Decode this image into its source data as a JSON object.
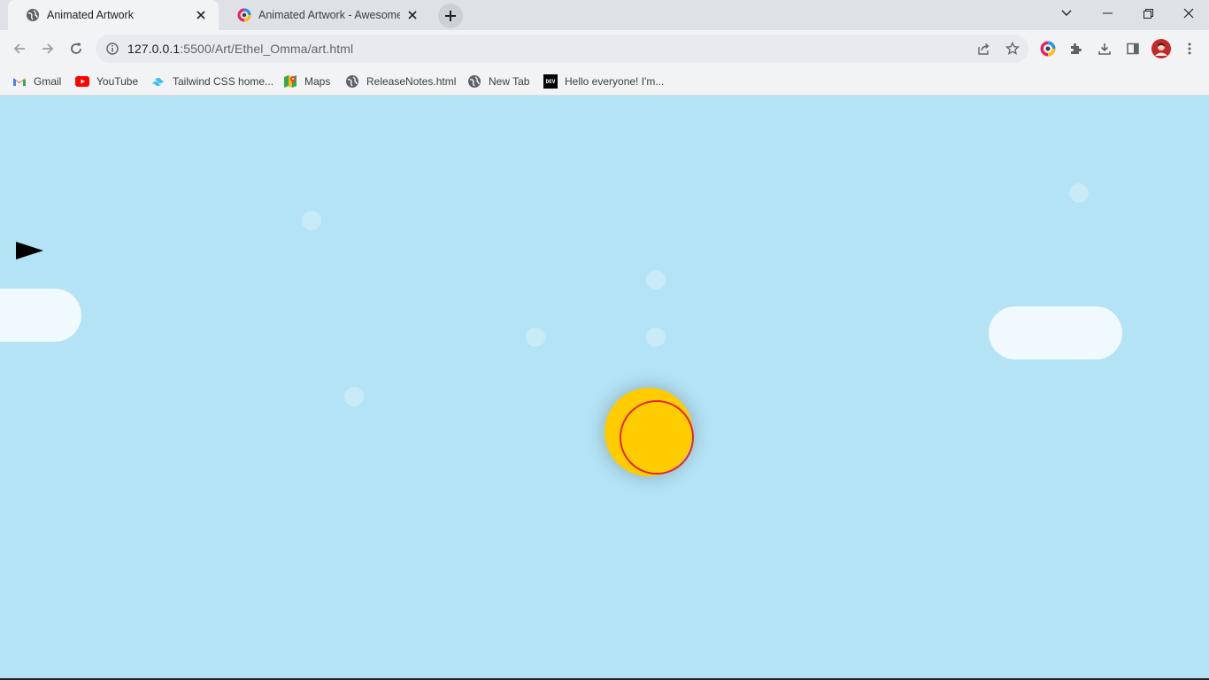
{
  "tabs": [
    {
      "title": "Animated Artwork",
      "active": true
    },
    {
      "title": "Animated Artwork - Awesome Sc",
      "active": false
    }
  ],
  "omnibox": {
    "url_host": "127.0.0.1",
    "url_path": ":5500/Art/Ethel_Omma/art.html"
  },
  "bookmarks": [
    {
      "label": "Gmail",
      "icon": "gmail-icon"
    },
    {
      "label": "YouTube",
      "icon": "youtube-icon"
    },
    {
      "label": "Tailwind CSS home...",
      "icon": "tailwind-icon"
    },
    {
      "label": "Maps",
      "icon": "maps-icon"
    },
    {
      "label": "ReleaseNotes.html",
      "icon": "globe-icon"
    },
    {
      "label": "New Tab",
      "icon": "globe-icon"
    },
    {
      "label": "Hello everyone! I'm...",
      "icon": "dev-icon",
      "icon_text": "DEV"
    }
  ],
  "colors": {
    "sky": "#b3e3f5",
    "cloud": "#f0f9fd",
    "sun": "#ffcc00",
    "sun_ring": "#e0283c",
    "plane": "#000000"
  }
}
